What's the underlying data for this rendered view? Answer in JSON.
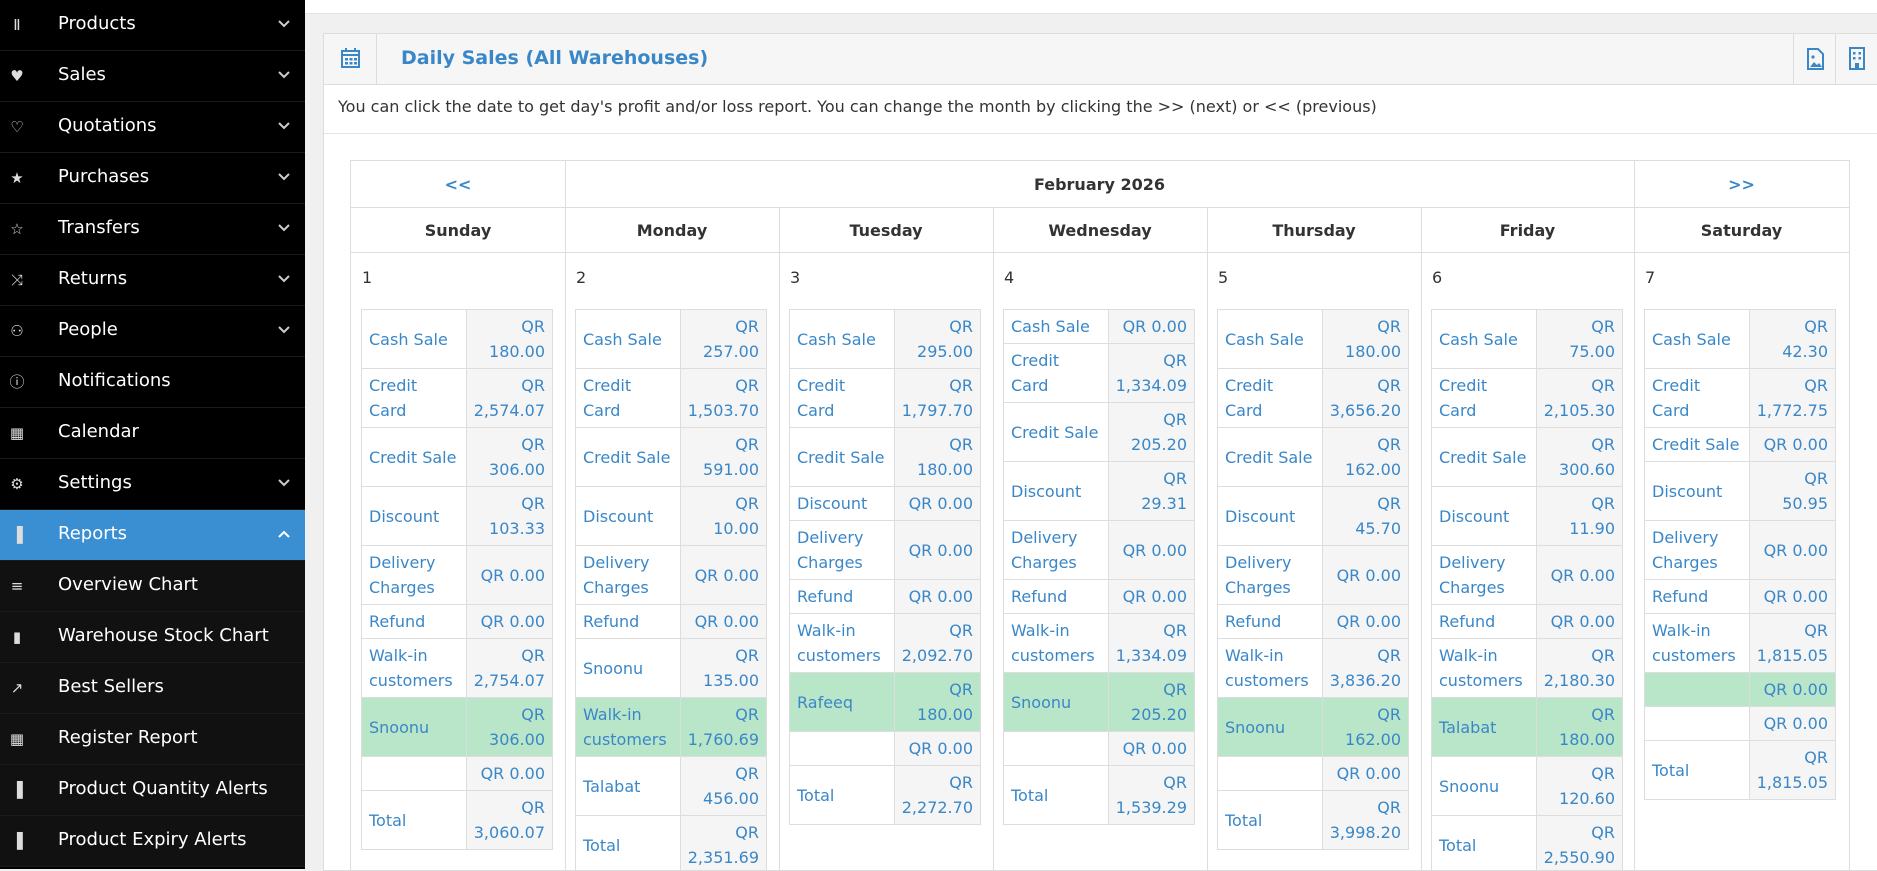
{
  "sidebar": {
    "items": [
      {
        "label": "Products",
        "icon": "barcode-icon",
        "glyph": "Ⅱ",
        "expandable": true,
        "chev": "down"
      },
      {
        "label": "Sales",
        "icon": "heart-icon",
        "glyph": "♥",
        "expandable": true,
        "chev": "down"
      },
      {
        "label": "Quotations",
        "icon": "heart-outline-icon",
        "glyph": "♡",
        "expandable": true,
        "chev": "down"
      },
      {
        "label": "Purchases",
        "icon": "star-icon",
        "glyph": "★",
        "expandable": true,
        "chev": "down"
      },
      {
        "label": "Transfers",
        "icon": "star-outline-icon",
        "glyph": "☆",
        "expandable": true,
        "chev": "down"
      },
      {
        "label": "Returns",
        "icon": "random-icon",
        "glyph": "⤨",
        "expandable": true,
        "chev": "down"
      },
      {
        "label": "People",
        "icon": "users-icon",
        "glyph": "⚇",
        "expandable": true,
        "chev": "down"
      },
      {
        "label": "Notifications",
        "icon": "info-icon",
        "glyph": "ⓘ",
        "expandable": false
      },
      {
        "label": "Calendar",
        "icon": "calendar-icon",
        "glyph": "▦",
        "expandable": false
      },
      {
        "label": "Settings",
        "icon": "gear-icon",
        "glyph": "⚙",
        "expandable": true,
        "chev": "down"
      },
      {
        "label": "Reports",
        "icon": "bar-chart-icon",
        "glyph": "▐",
        "expandable": true,
        "chev": "up",
        "active": true
      },
      {
        "label": "Overview Chart",
        "icon": "list-icon",
        "glyph": "≡",
        "sub": true
      },
      {
        "label": "Warehouse Stock Chart",
        "icon": "building-icon",
        "glyph": "▮",
        "sub": true
      },
      {
        "label": "Best Sellers",
        "icon": "line-chart-icon",
        "glyph": "↗",
        "sub": true
      },
      {
        "label": "Register Report",
        "icon": "th-large-icon",
        "glyph": "▦",
        "sub": true
      },
      {
        "label": "Product Quantity Alerts",
        "icon": "bar-chart-icon",
        "glyph": "▐",
        "sub": true
      },
      {
        "label": "Product Expiry Alerts",
        "icon": "bar-chart-icon",
        "glyph": "▐",
        "sub": true
      }
    ]
  },
  "header": {
    "title": "Daily Sales (All Warehouses)",
    "intro": "You can click the date to get day's profit and/or loss report. You can change the month by clicking the >> (next) or << (previous)"
  },
  "calendar": {
    "month": "February 2026",
    "prev": "<<",
    "next": ">>",
    "weekdays": [
      "Sunday",
      "Monday",
      "Tuesday",
      "Wednesday",
      "Thursday",
      "Friday",
      "Saturday"
    ],
    "days": [
      {
        "num": "1",
        "rows": [
          {
            "k": "Cash Sale",
            "v": "QR 180.00"
          },
          {
            "k": "Credit Card",
            "v": "QR 2,574.07"
          },
          {
            "k": "Credit Sale",
            "v": "QR 306.00"
          },
          {
            "k": "Discount",
            "v": "QR 103.33"
          },
          {
            "k": "Delivery Charges",
            "v": "QR 0.00"
          },
          {
            "k": "Refund",
            "v": "QR 0.00"
          },
          {
            "k": "Walk-in customers",
            "v": "QR 2,754.07"
          },
          {
            "k": "Snoonu",
            "v": "QR 306.00",
            "hl": true
          },
          {
            "k": "",
            "v": "QR 0.00"
          },
          {
            "k": "Total",
            "v": "QR 3,060.07"
          }
        ]
      },
      {
        "num": "2",
        "rows": [
          {
            "k": "Cash Sale",
            "v": "QR 257.00"
          },
          {
            "k": "Credit Card",
            "v": "QR 1,503.70"
          },
          {
            "k": "Credit Sale",
            "v": "QR 591.00"
          },
          {
            "k": "Discount",
            "v": "QR 10.00"
          },
          {
            "k": "Delivery Charges",
            "v": "QR 0.00"
          },
          {
            "k": "Refund",
            "v": "QR 0.00"
          },
          {
            "k": "Snoonu",
            "v": "QR 135.00"
          },
          {
            "k": "Walk-in customers",
            "v": "QR 1,760.69",
            "hl": true
          },
          {
            "k": "Talabat",
            "v": "QR 456.00"
          },
          {
            "k": "Total",
            "v": "QR 2,351.69"
          }
        ]
      },
      {
        "num": "3",
        "rows": [
          {
            "k": "Cash Sale",
            "v": "QR 295.00"
          },
          {
            "k": "Credit Card",
            "v": "QR 1,797.70"
          },
          {
            "k": "Credit Sale",
            "v": "QR 180.00"
          },
          {
            "k": "Discount",
            "v": "QR 0.00"
          },
          {
            "k": "Delivery Charges",
            "v": "QR 0.00"
          },
          {
            "k": "Refund",
            "v": "QR 0.00"
          },
          {
            "k": "Walk-in customers",
            "v": "QR 2,092.70"
          },
          {
            "k": "Rafeeq",
            "v": "QR 180.00",
            "hl": true
          },
          {
            "k": "",
            "v": "QR 0.00"
          },
          {
            "k": "Total",
            "v": "QR 2,272.70"
          }
        ]
      },
      {
        "num": "4",
        "rows": [
          {
            "k": "Cash Sale",
            "v": "QR 0.00"
          },
          {
            "k": "Credit Card",
            "v": "QR 1,334.09"
          },
          {
            "k": "Credit Sale",
            "v": "QR 205.20"
          },
          {
            "k": "Discount",
            "v": "QR 29.31"
          },
          {
            "k": "Delivery Charges",
            "v": "QR 0.00"
          },
          {
            "k": "Refund",
            "v": "QR 0.00"
          },
          {
            "k": "Walk-in customers",
            "v": "QR 1,334.09"
          },
          {
            "k": "Snoonu",
            "v": "QR 205.20",
            "hl": true
          },
          {
            "k": "",
            "v": "QR 0.00"
          },
          {
            "k": "Total",
            "v": "QR 1,539.29"
          }
        ]
      },
      {
        "num": "5",
        "rows": [
          {
            "k": "Cash Sale",
            "v": "QR 180.00"
          },
          {
            "k": "Credit Card",
            "v": "QR 3,656.20"
          },
          {
            "k": "Credit Sale",
            "v": "QR 162.00"
          },
          {
            "k": "Discount",
            "v": "QR 45.70"
          },
          {
            "k": "Delivery Charges",
            "v": "QR 0.00"
          },
          {
            "k": "Refund",
            "v": "QR 0.00"
          },
          {
            "k": "Walk-in customers",
            "v": "QR 3,836.20"
          },
          {
            "k": "Snoonu",
            "v": "QR 162.00",
            "hl": true
          },
          {
            "k": "",
            "v": "QR 0.00"
          },
          {
            "k": "Total",
            "v": "QR 3,998.20"
          }
        ]
      },
      {
        "num": "6",
        "rows": [
          {
            "k": "Cash Sale",
            "v": "QR 75.00"
          },
          {
            "k": "Credit Card",
            "v": "QR 2,105.30"
          },
          {
            "k": "Credit Sale",
            "v": "QR 300.60"
          },
          {
            "k": "Discount",
            "v": "QR 11.90"
          },
          {
            "k": "Delivery Charges",
            "v": "QR 0.00"
          },
          {
            "k": "Refund",
            "v": "QR 0.00"
          },
          {
            "k": "Walk-in customers",
            "v": "QR 2,180.30"
          },
          {
            "k": "Talabat",
            "v": "QR 180.00",
            "hl": true
          },
          {
            "k": "Snoonu",
            "v": "QR 120.60"
          },
          {
            "k": "Total",
            "v": "QR 2,550.90"
          }
        ]
      },
      {
        "num": "7",
        "rows": [
          {
            "k": "Cash Sale",
            "v": "QR 42.30"
          },
          {
            "k": "Credit Card",
            "v": "QR 1,772.75"
          },
          {
            "k": "Credit Sale",
            "v": "QR 0.00"
          },
          {
            "k": "Discount",
            "v": "QR 50.95"
          },
          {
            "k": "Delivery Charges",
            "v": "QR 0.00"
          },
          {
            "k": "Refund",
            "v": "QR 0.00"
          },
          {
            "k": "Walk-in customers",
            "v": "QR 1,815.05"
          },
          {
            "k": "",
            "v": "QR 0.00",
            "hl": true
          },
          {
            "k": "",
            "v": "QR 0.00"
          },
          {
            "k": "Total",
            "v": "QR 1,815.05"
          }
        ]
      }
    ]
  },
  "colors": {
    "accent": "#3a87c8",
    "sidebar_bg": "#000000",
    "active_bg": "#3a8fd3",
    "highlight": "#b9e6c9"
  }
}
